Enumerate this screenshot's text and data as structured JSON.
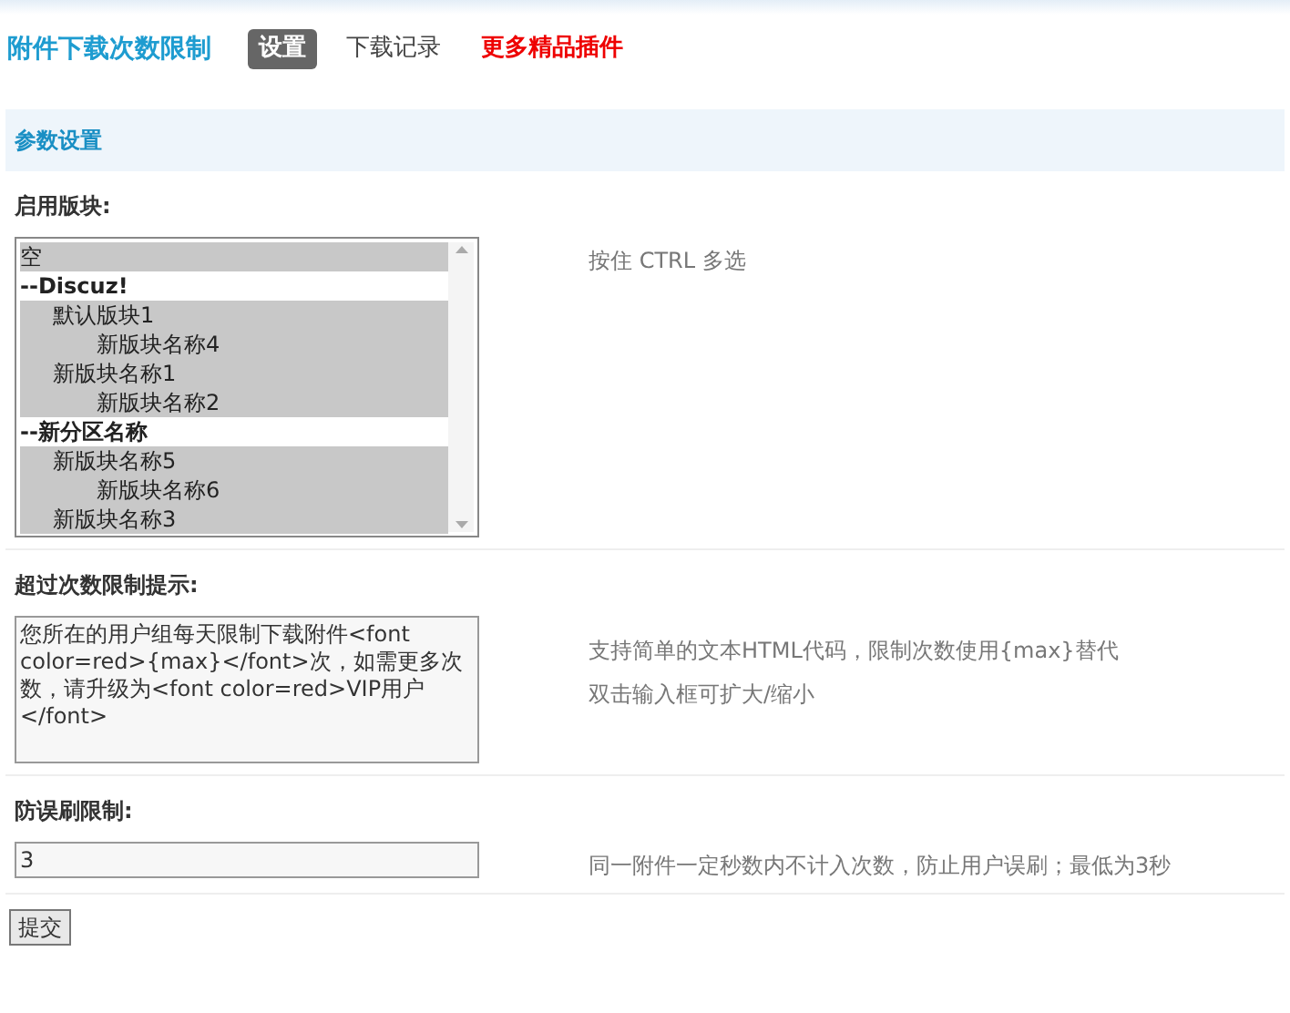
{
  "header": {
    "title": "附件下载次数限制",
    "tabs": [
      {
        "label": "设置",
        "selected": true,
        "kind": "tab"
      },
      {
        "label": "下载记录",
        "selected": false,
        "kind": "tab"
      },
      {
        "label": "更多精品插件",
        "selected": false,
        "kind": "promo"
      }
    ]
  },
  "section": {
    "title": "参数设置"
  },
  "fields": [
    {
      "kind": "listbox",
      "label": "启用版块:",
      "tip": [
        "按住 CTRL 多选"
      ],
      "options": [
        {
          "kind": "option",
          "label": "空",
          "selected": true
        },
        {
          "kind": "group",
          "label": "--Discuz!",
          "children": [
            {
              "kind": "option",
              "label": "默认版块1",
              "selected": true,
              "children": [
                {
                  "kind": "option",
                  "label": "新版块名称4",
                  "selected": true
                }
              ]
            },
            {
              "kind": "option",
              "label": "新版块名称1",
              "selected": true,
              "children": [
                {
                  "kind": "option",
                  "label": "新版块名称2",
                  "selected": true
                }
              ]
            }
          ]
        },
        {
          "kind": "group",
          "label": "--新分区名称",
          "children": [
            {
              "kind": "option",
              "label": "新版块名称5",
              "selected": true,
              "children": [
                {
                  "kind": "option",
                  "label": "新版块名称6",
                  "selected": true
                }
              ]
            },
            {
              "kind": "option",
              "label": "新版块名称3",
              "selected": true
            }
          ]
        }
      ]
    },
    {
      "kind": "textarea",
      "label": "超过次数限制提示:",
      "value": "您所在的用户组每天限制下载附件<font color=red>{max}</font>次，如需更多次数，请升级为<font color=red>VIP用户</font>",
      "tip": [
        "支持简单的文本HTML代码，限制次数使用{max}替代",
        "双击输入框可扩大/缩小"
      ]
    },
    {
      "kind": "input",
      "label": "防误刷限制:",
      "value": "3",
      "tip": [
        "同一附件一定秒数内不计入次数，防止用户误刷；最低为3秒"
      ]
    }
  ],
  "submit": {
    "label": "提交"
  }
}
